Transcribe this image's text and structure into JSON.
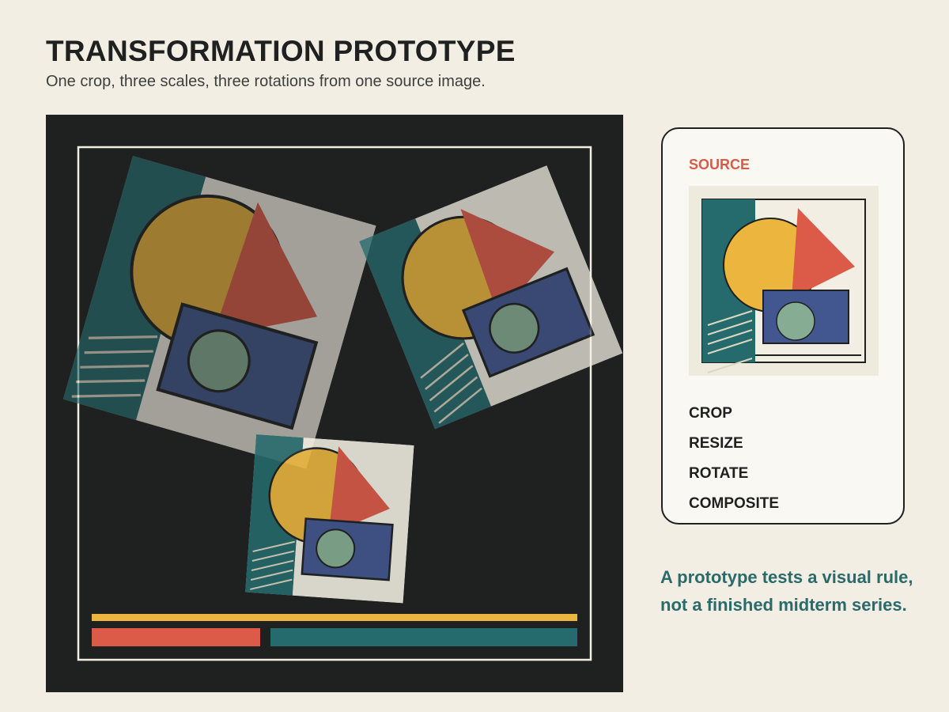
{
  "header": {
    "title": "TRANSFORMATION PROTOTYPE",
    "subtitle": "One crop, three scales, three rotations from one source image."
  },
  "panel": {
    "source_label": "SOURCE",
    "steps": [
      "CROP",
      "RESIZE",
      "ROTATE",
      "COMPOSITE"
    ]
  },
  "note": {
    "line1": "A prototype tests a visual rule,",
    "line2": "not a finished midterm series."
  },
  "colors": {
    "background": "#f2eee3",
    "canvas": "#1f2120",
    "teal": "#256a6c",
    "mustard": "#ebb53e",
    "coral": "#dc5b48",
    "navy": "#42578f",
    "sage": "#86ad93",
    "paper": "#f2eee3"
  }
}
